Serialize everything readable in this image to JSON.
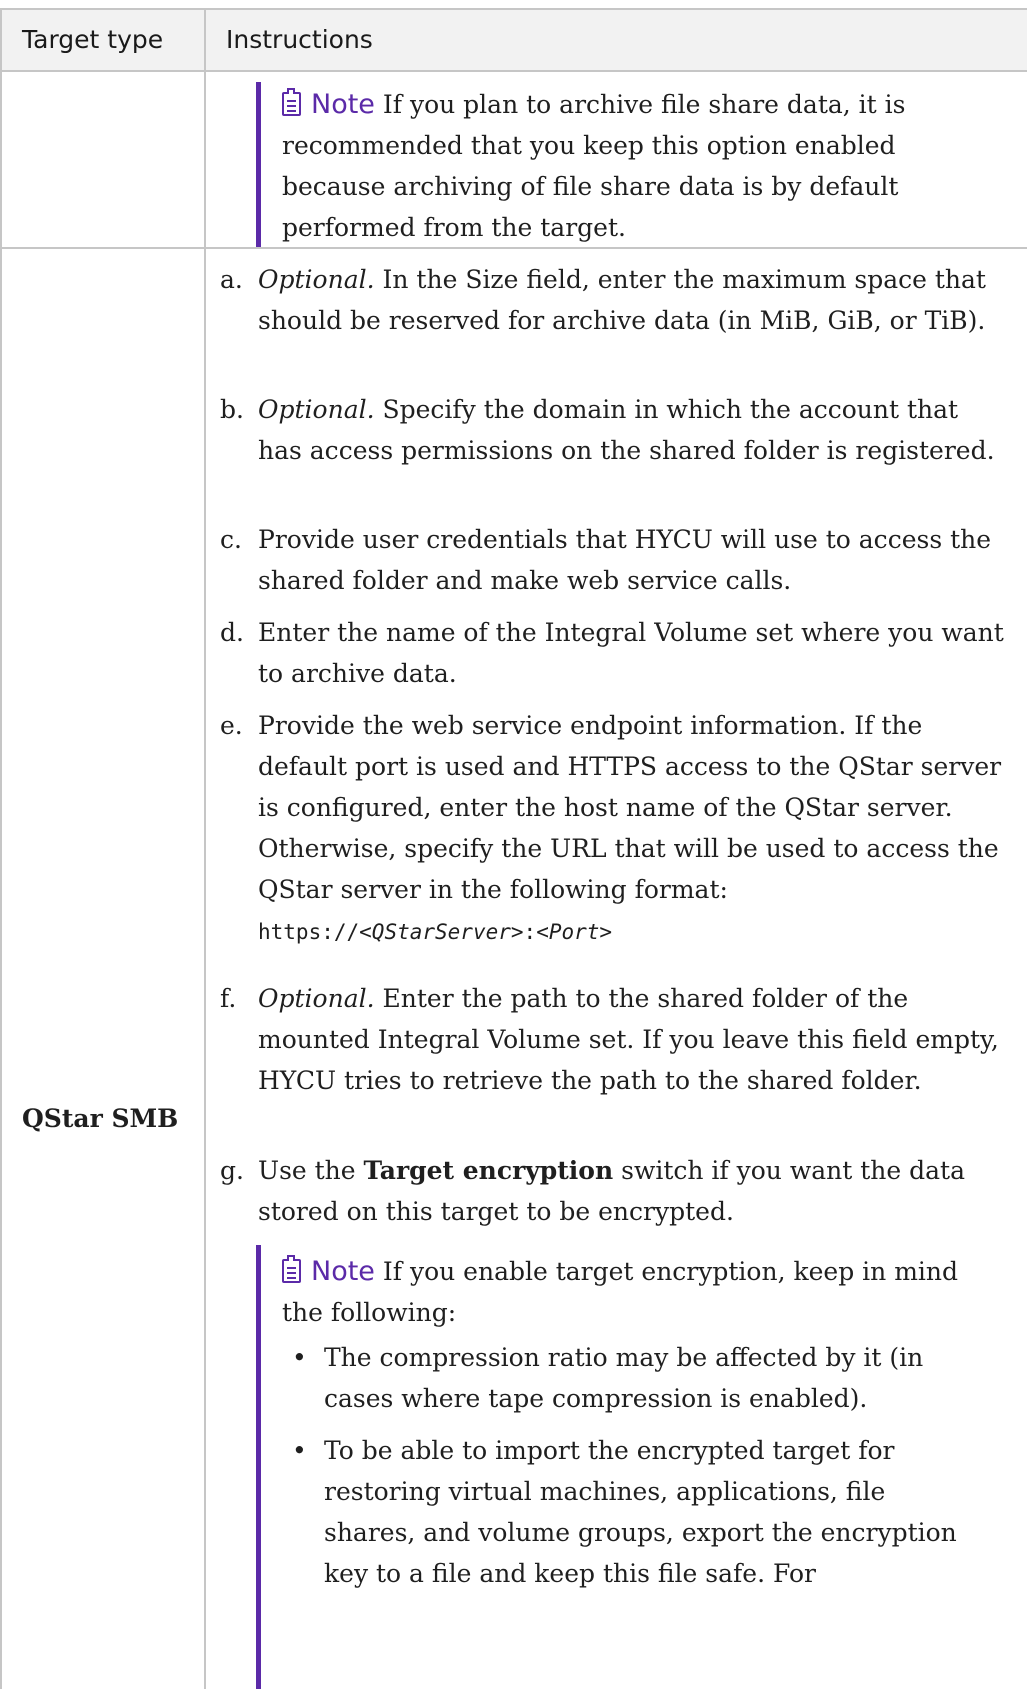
{
  "header": {
    "col1": "Target type",
    "col2": "Instructions"
  },
  "row1": {
    "note_label": "Note",
    "note_text": "If you plan to archive file share data, it is recommended that you keep this option enabled because archiving of file share data is by default performed from the target."
  },
  "row2": {
    "label": "QStar SMB",
    "items": [
      {
        "marker": "a.",
        "optional": "Optional.",
        "text": "In the Size field, enter the maximum space that should be reserved for archive data (in MiB, GiB, or TiB)."
      },
      {
        "marker": "b.",
        "optional": "Optional.",
        "text": "Specify the domain in which the account that has access permissions on the shared folder is registered."
      },
      {
        "marker": "c.",
        "text": "Provide user credentials that HYCU will use to access the shared folder and make web service calls."
      },
      {
        "marker": "d.",
        "text": "Enter the name of the Integral Volume set where you want to archive data."
      },
      {
        "marker": "e.",
        "text": "Provide the web service endpoint information. If the default port is used and HTTPS access to the QStar server is configured, enter the host name of the QStar server. Otherwise, specify the URL that will be used to access the QStar server in the following format:",
        "code_prefix": "https://",
        "code_server": "<QStarServer>",
        "code_sep": ":",
        "code_port": "<Port>"
      },
      {
        "marker": "f.",
        "optional": "Optional.",
        "text": "Enter the path to the shared folder of the mounted Integral Volume set. If you leave this field empty, HYCU tries to retrieve the path to the shared folder."
      },
      {
        "marker": "g.",
        "text_before": "Use the",
        "bold": "Target encryption",
        "text_after": "switch if you want the data stored on this target to be encrypted."
      }
    ],
    "note_label": "Note",
    "note_text": "If you enable target encryption, keep in mind the following:",
    "bullets": [
      "The compression ratio may be affected by it (in cases where tape compression is enabled).",
      "To be able to import the encrypted target for restoring virtual machines, applications, file shares, and volume groups, export the encryption key to a file and keep this file safe. For"
    ]
  }
}
